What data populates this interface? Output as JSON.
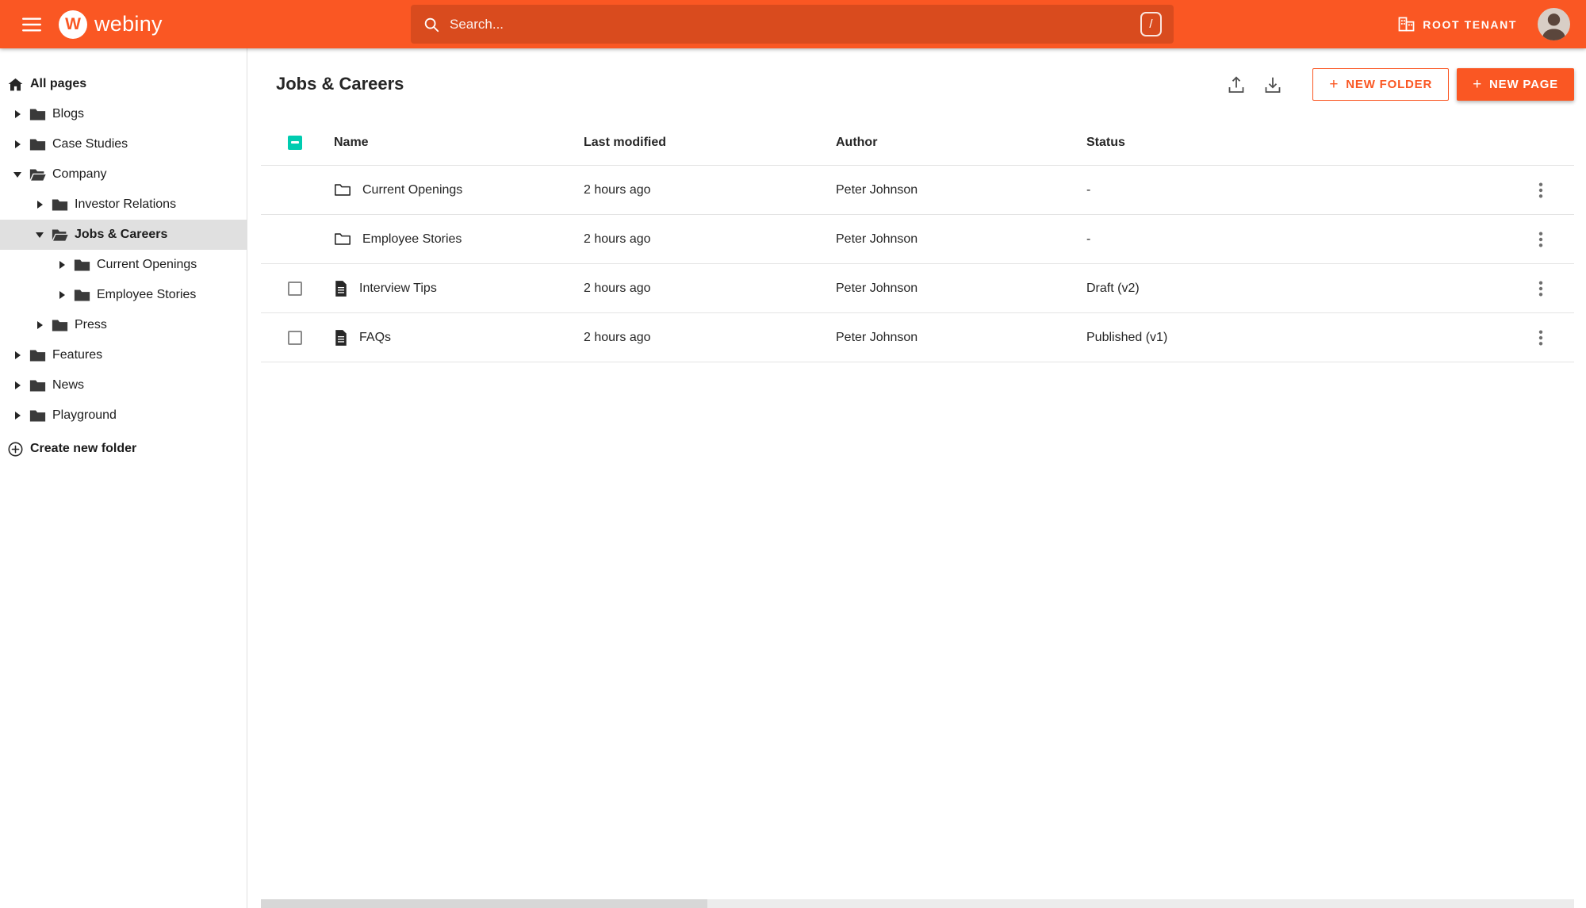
{
  "topbar": {
    "logo_monogram": "W",
    "logo_text": "webiny",
    "search_placeholder": "Search...",
    "search_shortcut": "/",
    "tenant_label": "ROOT TENANT"
  },
  "sidebar": {
    "all_pages_label": "All pages",
    "items": [
      {
        "label": "Blogs",
        "level": 0,
        "expanded": false
      },
      {
        "label": "Case Studies",
        "level": 0,
        "expanded": false
      },
      {
        "label": "Company",
        "level": 0,
        "expanded": true
      },
      {
        "label": "Investor Relations",
        "level": 1,
        "expanded": false
      },
      {
        "label": "Jobs & Careers",
        "level": 1,
        "expanded": true,
        "selected": true
      },
      {
        "label": "Current Openings",
        "level": 2,
        "expanded": false
      },
      {
        "label": "Employee Stories",
        "level": 2,
        "expanded": false
      },
      {
        "label": "Press",
        "level": 1,
        "expanded": false
      },
      {
        "label": "Features",
        "level": 0,
        "expanded": false
      },
      {
        "label": "News",
        "level": 0,
        "expanded": false
      },
      {
        "label": "Playground",
        "level": 0,
        "expanded": false
      }
    ],
    "create_folder_label": "Create new folder"
  },
  "main": {
    "title": "Jobs & Careers",
    "new_folder_button": "NEW FOLDER",
    "new_page_button": "NEW PAGE",
    "table": {
      "headers": {
        "name": "Name",
        "last_modified": "Last modified",
        "author": "Author",
        "status": "Status"
      },
      "rows": [
        {
          "type": "folder",
          "name": "Current Openings",
          "last_modified": "2 hours ago",
          "author": "Peter Johnson",
          "status": "-"
        },
        {
          "type": "folder",
          "name": "Employee Stories",
          "last_modified": "2 hours ago",
          "author": "Peter Johnson",
          "status": "-"
        },
        {
          "type": "page",
          "name": "Interview Tips",
          "last_modified": "2 hours ago",
          "author": "Peter Johnson",
          "status": "Draft (v2)"
        },
        {
          "type": "page",
          "name": "FAQs",
          "last_modified": "2 hours ago",
          "author": "Peter Johnson",
          "status": "Published (v1)"
        }
      ]
    }
  },
  "icons": {
    "plus": "+"
  },
  "colors": {
    "brand_orange": "#FA5723",
    "checkbox_teal": "#00CCB0",
    "selected_gray": "#E0E0E0"
  }
}
